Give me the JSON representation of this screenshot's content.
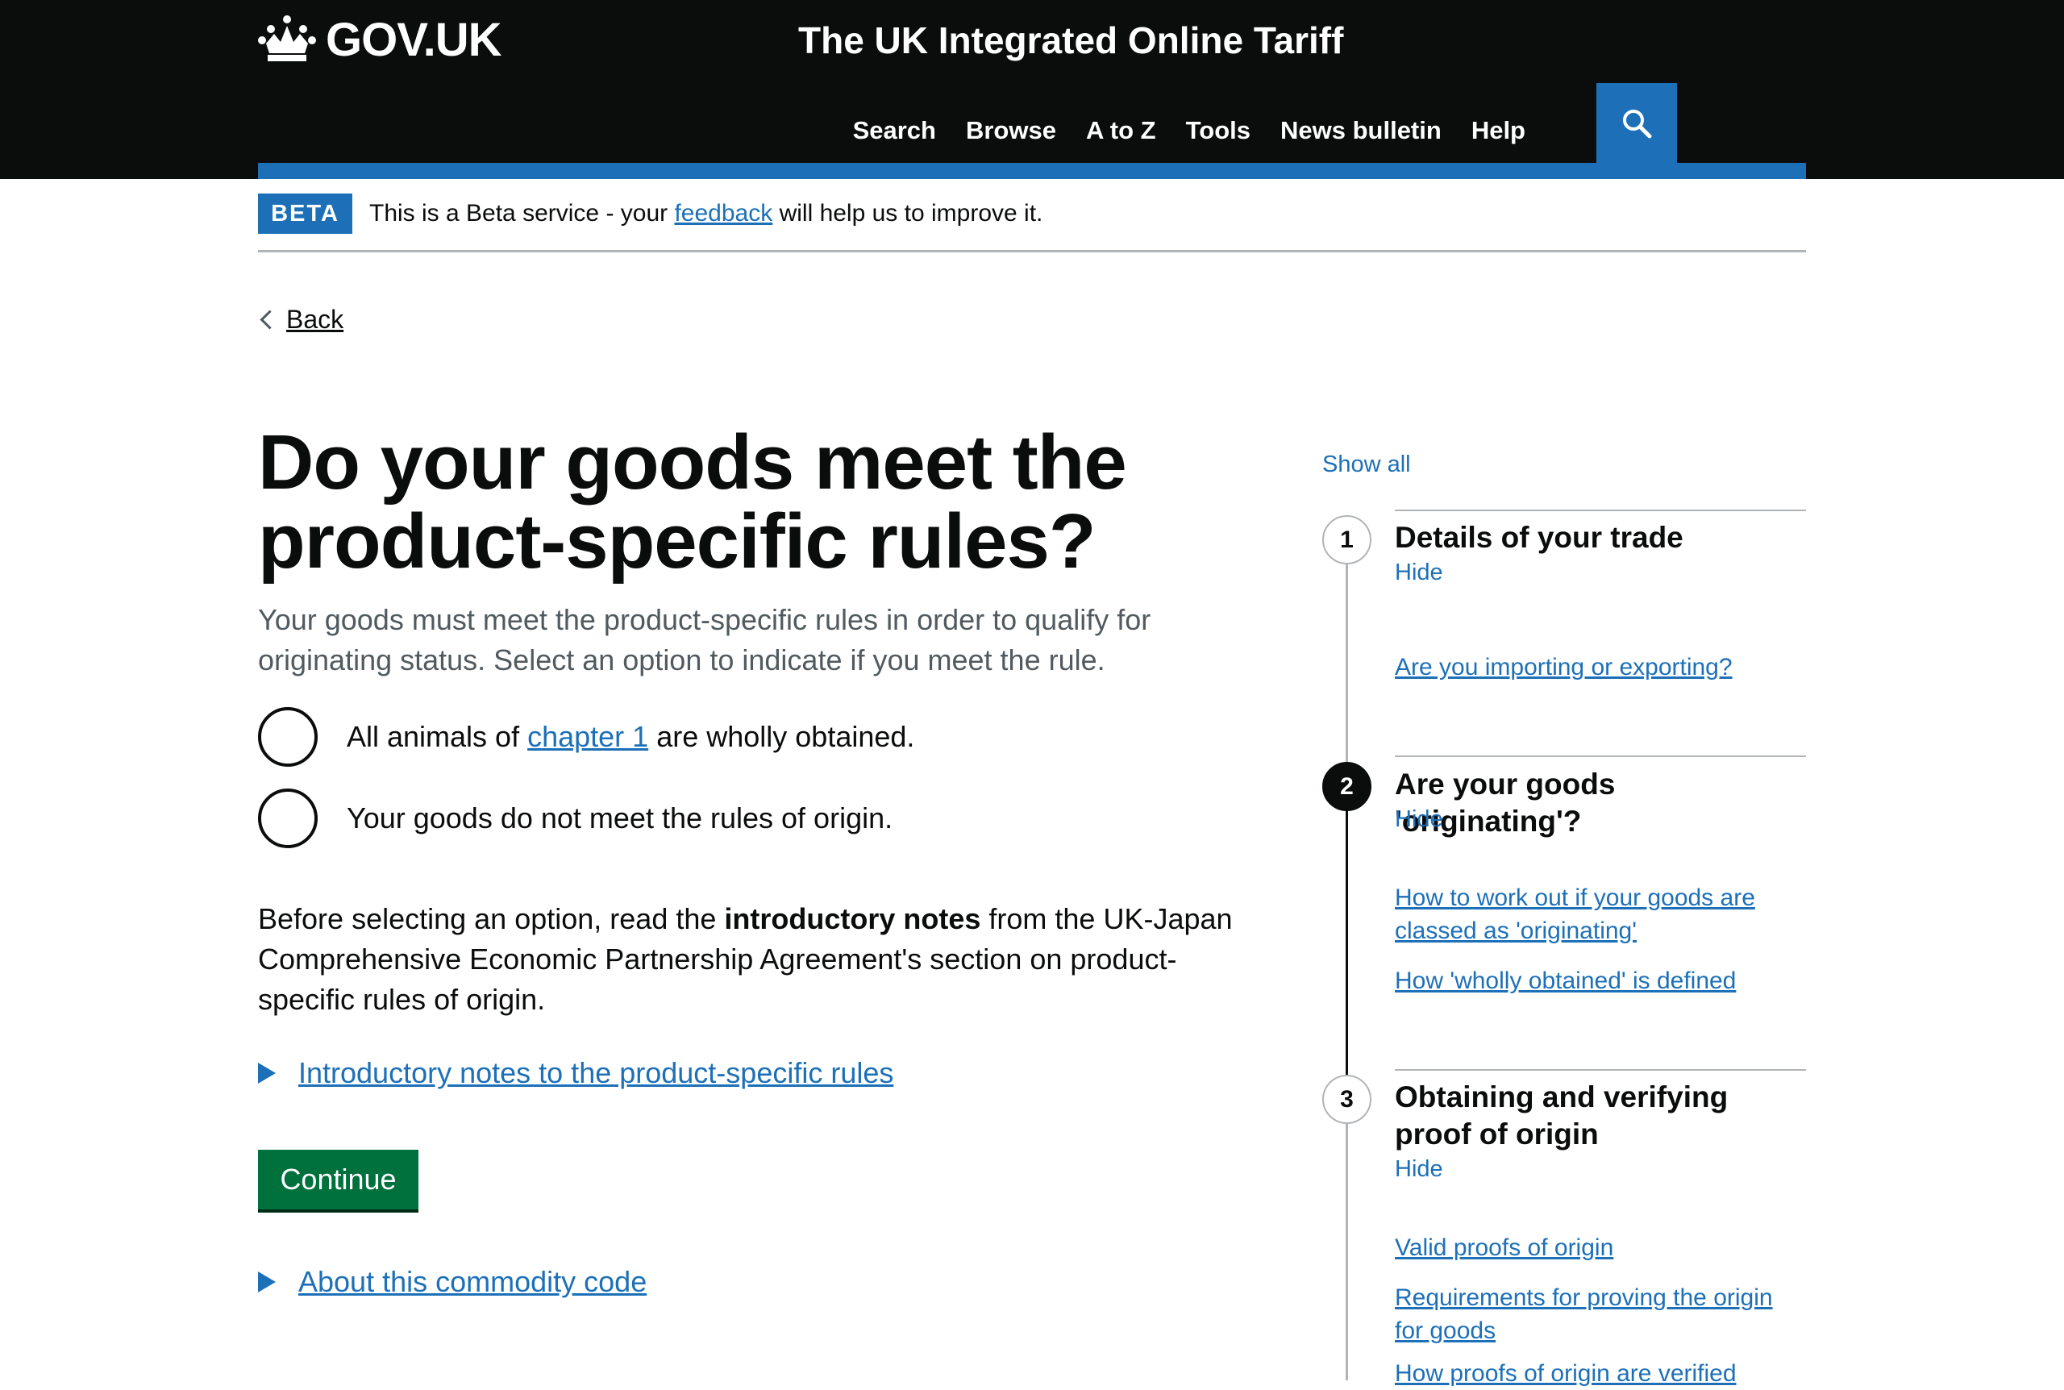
{
  "header": {
    "logo_text": "GOV.UK",
    "service_name": "The UK Integrated Online Tariff",
    "nav": [
      "Search",
      "Browse",
      "A to Z",
      "Tools",
      "News bulletin",
      "Help"
    ],
    "search_icon": "search-icon",
    "colors": {
      "background": "#0b0c0c",
      "accent": "#1d70b8"
    }
  },
  "beta": {
    "tag": "BETA",
    "text_before": "This is a Beta service - your ",
    "link": "feedback",
    "text_after": " will help us to improve it."
  },
  "back": {
    "label": "Back"
  },
  "main": {
    "title": "Do your goods meet the product-specific rules?",
    "lede": "Your goods must meet the product-specific rules in order to qualify for originating status. Select an option to indicate if you meet the rule.",
    "options": [
      {
        "before": "All animals of ",
        "link": "chapter 1",
        "after": " are wholly obtained."
      },
      {
        "text": "Your goods do not meet the rules of origin."
      }
    ],
    "para_before": "Before selecting an option, read the ",
    "para_bold": "introductory notes",
    "para_after": " from the UK-Japan Comprehensive Economic Partnership Agreement's section on product-specific rules of origin.",
    "details_intro": "Introductory notes to the product-specific rules",
    "continue": "Continue",
    "details_commodity": "About this commodity code",
    "colors": {
      "button": "#00703c",
      "link": "#1d70b8"
    }
  },
  "sidebar": {
    "show_all": "Show all",
    "steps": [
      {
        "number": "1",
        "title": "Details of your trade",
        "toggle": "Hide",
        "links": [
          "Are you importing or exporting?"
        ]
      },
      {
        "number": "2",
        "title": "Are your goods 'originating'?",
        "toggle": "Hide",
        "links": [
          "How to work out if your goods are classed as 'originating'",
          "How 'wholly obtained' is defined"
        ]
      },
      {
        "number": "3",
        "title": "Obtaining and verifying proof of origin",
        "toggle": "Hide",
        "links": [
          "Valid proofs of origin",
          "Requirements for proving the origin for goods",
          "How proofs of origin are verified"
        ]
      }
    ]
  }
}
